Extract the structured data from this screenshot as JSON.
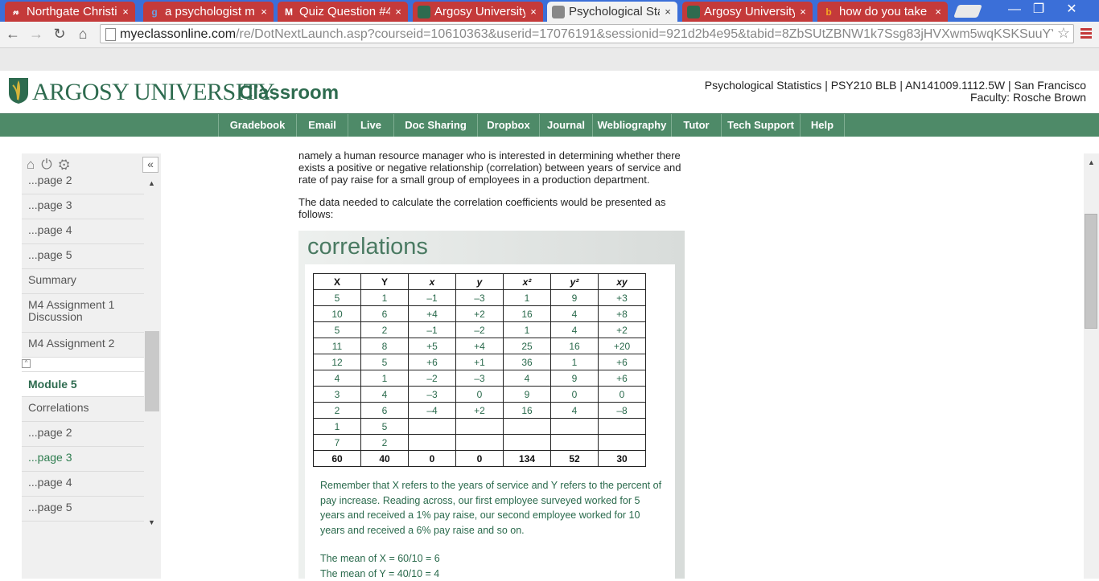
{
  "browser": {
    "tabs": [
      {
        "icon": "𝓃",
        "title": "Northgate Christi",
        "icon_color": "#ffffff"
      },
      {
        "icon": "g",
        "title": "a psychologist m",
        "icon_color": "#6aa0e0"
      },
      {
        "icon": "M",
        "title": "Quiz Question #4",
        "icon_color": "#ffffff"
      },
      {
        "icon": "",
        "title": "Argosy University",
        "icon_color": "#2e6b4f"
      },
      {
        "icon": "",
        "title": "Psychological Sta",
        "icon_color": "#888888"
      },
      {
        "icon": "",
        "title": "Argosy University",
        "icon_color": "#2e6b4f"
      },
      {
        "icon": "b",
        "title": "how do you take",
        "icon_color": "#f5a623"
      }
    ],
    "tab_close": "×",
    "url_host": "myeclassonline.com",
    "url_path": "/re/DotNextLaunch.asp?courseid=10610363&userid=17076191&sessionid=921d2b4e95&tabid=8ZbSUtZBNW1k7Ssg83jHVXwm5wqKSKSuuYYr",
    "win_minimize": "—",
    "win_restore": "❐",
    "win_close": "✕"
  },
  "header": {
    "logo_text": "ARGOSY UNIVERSITY.",
    "logo_class": "Classroom",
    "course_line1": "Psychological Statistics | PSY210 BLB | AN141009.1112.5W | San Francisco",
    "course_line2": "Faculty:  Rosche Brown"
  },
  "nav": [
    "Gradebook",
    "Email",
    "Live",
    "Doc Sharing",
    "Dropbox",
    "Journal",
    "Webliography",
    "Tutor",
    "Tech Support",
    "Help"
  ],
  "sidebar": {
    "collapse": "«",
    "items_top": [
      "...page 2",
      "...page 3",
      "...page 4",
      "...page 5",
      "Summary",
      "M4 Assignment 1 Discussion",
      "M4 Assignment 2"
    ],
    "mini_marker": "^",
    "module": "Module 5",
    "items_bottom": [
      "Correlations",
      "...page 2",
      "...page 3",
      "...page 4",
      "...page 5"
    ]
  },
  "article": {
    "para1": "namely a human resource manager who is interested in determining whether there exists a positive or negative relationship (correlation) between years of service and rate of pay raise for a small group of employees in a production department.",
    "para2": "The data needed to calculate the correlation coefficients would be presented as follows:"
  },
  "figure": {
    "title": "correlations",
    "headers": [
      "X",
      "Y",
      "x",
      "y",
      "x²",
      "y²",
      "xy"
    ],
    "rows": [
      [
        "5",
        "1",
        "–1",
        "–3",
        "1",
        "9",
        "+3"
      ],
      [
        "10",
        "6",
        "+4",
        "+2",
        "16",
        "4",
        "+8"
      ],
      [
        "5",
        "2",
        "–1",
        "–2",
        "1",
        "4",
        "+2"
      ],
      [
        "11",
        "8",
        "+5",
        "+4",
        "25",
        "16",
        "+20"
      ],
      [
        "12",
        "5",
        "+6",
        "+1",
        "36",
        "1",
        "+6"
      ],
      [
        "4",
        "1",
        "–2",
        "–3",
        "4",
        "9",
        "+6"
      ],
      [
        "3",
        "4",
        "–3",
        "0",
        "9",
        "0",
        "0"
      ],
      [
        "2",
        "6",
        "–4",
        "+2",
        "16",
        "4",
        "–8"
      ],
      [
        "1",
        "5",
        "",
        "",
        "",
        "",
        ""
      ],
      [
        "7",
        "2",
        "",
        "",
        "",
        "",
        ""
      ]
    ],
    "totals": [
      "60",
      "40",
      "0",
      "0",
      "134",
      "52",
      "30"
    ],
    "explanation": "Remember that X refers to the years of service and Y refers to the percent of pay increase. Reading across, our first employee surveyed worked for 5 years and received a 1% pay raise, our second employee worked for 10 years and received a 6% pay raise and so on.",
    "mean_x": "The mean of X = 60/10 = 6",
    "mean_y": "The mean of Y = 40/10 = 4"
  }
}
